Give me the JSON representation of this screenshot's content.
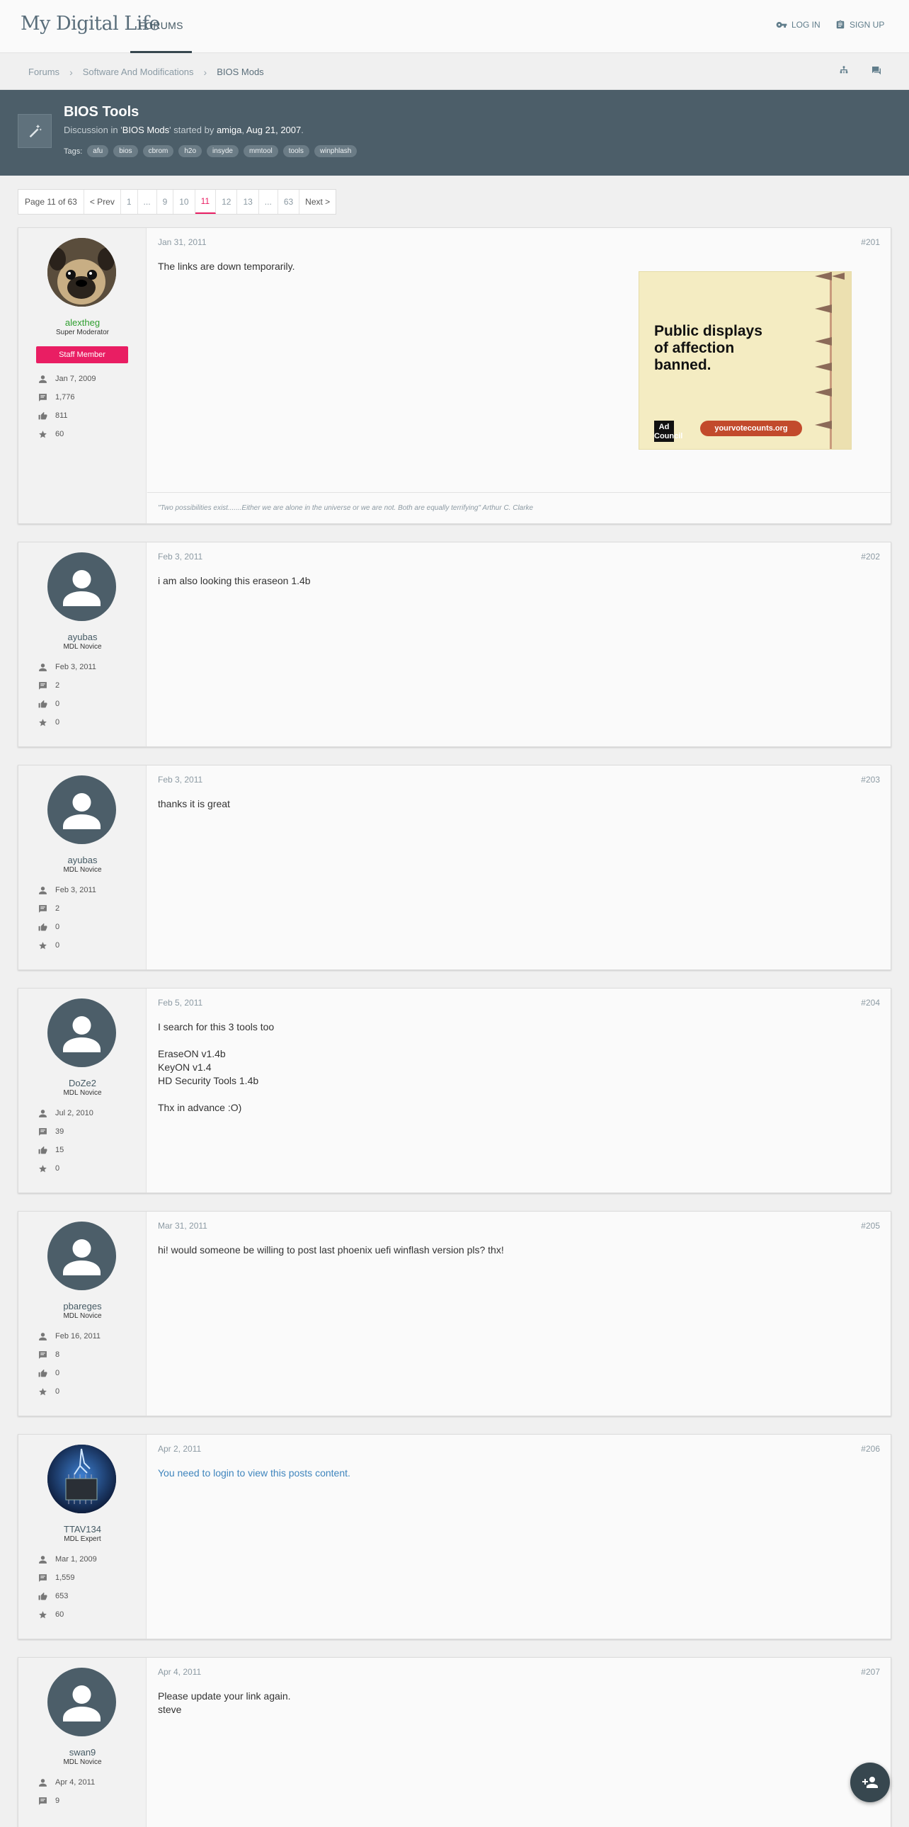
{
  "header": {
    "logo_text": "My Digital Life",
    "nav_forums": "FORUMS",
    "login": "LOG IN",
    "signup": "SIGN UP"
  },
  "breadcrumb": [
    "Forums",
    "Software And Modifications",
    "BIOS Mods"
  ],
  "thread": {
    "title": "BIOS Tools",
    "meta_prefix": "Discussion in '",
    "forum": "BIOS Mods",
    "meta_mid": "' started by ",
    "author": "amiga",
    "meta_sep": ", ",
    "date": "Aug 21, 2007",
    "meta_end": ".",
    "tags_label": "Tags:",
    "tags": [
      "afu",
      "bios",
      "cbrom",
      "h2o",
      "insyde",
      "mmtool",
      "tools",
      "winphlash"
    ]
  },
  "pagination": {
    "label": "Page 11 of 63",
    "prev": "< Prev",
    "pages": [
      "1",
      "...",
      "9",
      "10",
      "11",
      "12",
      "13",
      "...",
      "63"
    ],
    "active": "11",
    "next": "Next >"
  },
  "posts": [
    {
      "user": "alextheg",
      "title": "Super Moderator",
      "banner": "Staff Member",
      "joined": "Jan 7, 2009",
      "messages": "1,776",
      "likes": "811",
      "points": "60",
      "date": "Jan 31, 2011",
      "num": "#201",
      "text": "The links are down temporarily.",
      "signature": "\"Two possibilities exist.......Either we are alone in the universe or we are not. Both are equally terrifying\" Arthur C. Clarke"
    },
    {
      "user": "ayubas",
      "title": "MDL Novice",
      "joined": "Feb 3, 2011",
      "messages": "2",
      "likes": "0",
      "points": "0",
      "date": "Feb 3, 2011",
      "num": "#202",
      "text": "i am also looking this eraseon 1.4b"
    },
    {
      "user": "ayubas",
      "title": "MDL Novice",
      "joined": "Feb 3, 2011",
      "messages": "2",
      "likes": "0",
      "points": "0",
      "date": "Feb 3, 2011",
      "num": "#203",
      "text": "thanks it is great"
    },
    {
      "user": "DoZe2",
      "title": "MDL Novice",
      "joined": "Jul 2, 2010",
      "messages": "39",
      "likes": "15",
      "points": "0",
      "date": "Feb 5, 2011",
      "num": "#204",
      "text": "I search for this 3 tools too\n\nEraseON v1.4b\nKeyON v1.4\nHD Security Tools 1.4b\n\nThx in advance :O)"
    },
    {
      "user": "pbareges",
      "title": "MDL Novice",
      "joined": "Feb 16, 2011",
      "messages": "8",
      "likes": "0",
      "points": "0",
      "date": "Mar 31, 2011",
      "num": "#205",
      "text": "hi! would someone be willing to post last phoenix uefi winflash version pls? thx!"
    },
    {
      "user": "TTAV134",
      "title": "MDL Expert",
      "joined": "Mar 1, 2009",
      "messages": "1,559",
      "likes": "653",
      "points": "60",
      "date": "Apr 2, 2011",
      "num": "#206",
      "text": "You need to login to view this posts content."
    },
    {
      "user": "swan9",
      "title": "MDL Novice",
      "joined": "Apr 4, 2011",
      "messages": "9",
      "date": "Apr 4, 2011",
      "num": "#207",
      "text": "Please update your link again.\nsteve"
    }
  ],
  "ad": {
    "headline": "Public displays\nof affection\nbanned.",
    "url": "yourvotecounts.org",
    "logo": "Ad\nCouncil"
  },
  "colors": {
    "accent": "#e91e63",
    "header_bg": "#4c5e69",
    "link": "#3f85bd",
    "moderator_name": "#2e9e2e"
  }
}
